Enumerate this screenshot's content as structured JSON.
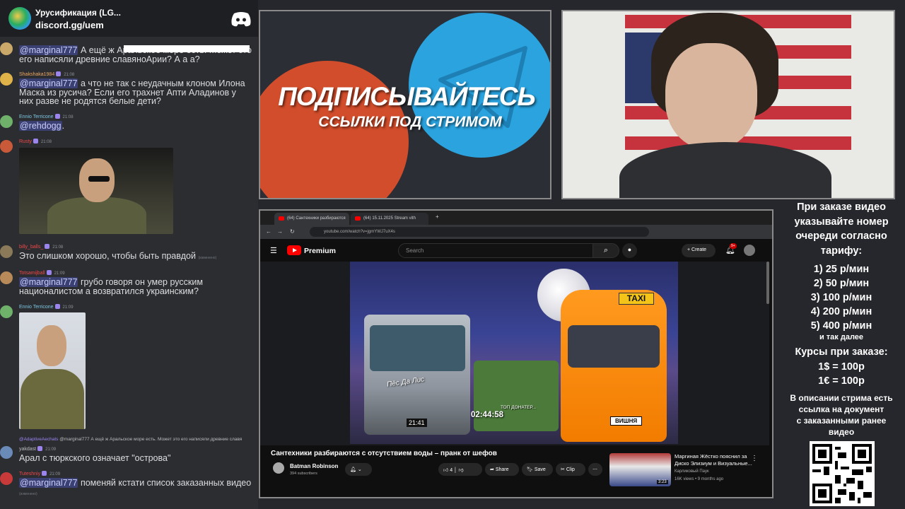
{
  "chat": {
    "server_name": "Урусификация (LG...",
    "server_link": "discord.gg/uem",
    "messages": [
      {
        "text_pre": "",
        "mention": "@marginal777",
        "text": " А ещё ж Аральское море есть. Может это его написяли древние славяноАрии? А а а?"
      },
      {
        "user": "Shakshaka1984",
        "time": "21:08",
        "mention": "@marginal777",
        "text": " а что не так с неудачным клоном Илона Маска из русича? Если его трахнет Апти Аладинов у них разве не родятся белые дети?"
      },
      {
        "user": "Ennio Terricone",
        "time": "21:08",
        "mention": "@rehdogg",
        "text": "."
      },
      {
        "user": "Rusty",
        "time": "21:08"
      },
      {
        "user": "billy_balls_",
        "time": "21:08",
        "text": "Это слишком хорошо, чтобы быть правдой",
        "edited": "(изменено)"
      },
      {
        "user": "Totsamijball",
        "time": "21:09",
        "mention": "@marginal777",
        "text": " грубо говоря он умер русским националистом а возвратился украинским?"
      },
      {
        "user": "Ennio Terricone",
        "time": "21:09"
      },
      {
        "reply": "@marginal777 А ещё ж Аральское море есть. Может это его написяли древние славя",
        "reply_user": "@AdaptiveAechats",
        "user": "yakdast",
        "time": "21:09",
        "text": "Арал с тюркского означает \"острова\""
      },
      {
        "user": "Tuteshniy",
        "time": "21:09",
        "mention": "@marginal777",
        "text": " поменяй кстати список заказанных видео",
        "edited": "(изменено)"
      }
    ]
  },
  "promo": {
    "title": "ПОДПИСЫВАЙТЕСЬ",
    "subtitle": "ССЫЛКИ ПОД СТРИМОМ"
  },
  "browser": {
    "tabs": [
      "(64) Сантехники разбираются",
      "(64) 15.11.2025 Stream vith"
    ],
    "url": "youtube.com/watch?v=jgmYWJ7uX4s"
  },
  "youtube": {
    "brand": "Premium",
    "search_placeholder": "Search",
    "create_label": "Create",
    "notif_count": "9+",
    "duration": "02:44:58",
    "plate": "ВИШНЯ",
    "taxi": "TAXI",
    "dog_label": "Пёс Да Лис",
    "top_donater": "ТОП ДОНАТЕР...",
    "truck_clock": "21:41",
    "video_title": "Сантехники разбираются с отсутствием воды – пранк от шефов",
    "channel_name": "Batman Robinson",
    "channel_subs": "394 subscribers",
    "likes": "4",
    "share": "Share",
    "save": "Save",
    "clip": "Clip",
    "side_title": "Маргиная Жёстко пояснил за Диско Элизиум и Визуальные...",
    "side_channel": "Карликовый Паук",
    "side_meta": "16K views • 9 months ago",
    "side_duration": "3:23"
  },
  "info": {
    "intro": [
      "При заказе видео",
      "указывайте номер",
      "очереди согласно",
      "тарифу:"
    ],
    "tariffs": [
      "1) 25 р/мин",
      "2) 50 р/мин",
      "3) 100 р/мин",
      "4) 200 р/мин",
      "5) 400 р/мин"
    ],
    "and_more": "и так далее",
    "rates_title": "Курсы при заказе:",
    "rates": [
      "1$ = 100р",
      "1€ = 100р"
    ],
    "note": [
      "В описании стрима есть",
      "ссылка на документ",
      "с заказанными ранее",
      "видео"
    ]
  },
  "colors": {
    "chat_bg": "#2b2d31",
    "mention": "#c9cdfb",
    "youtube_red": "#ff0000",
    "telegram_blue": "#2aa3df",
    "promo_red": "#d24d2b"
  }
}
